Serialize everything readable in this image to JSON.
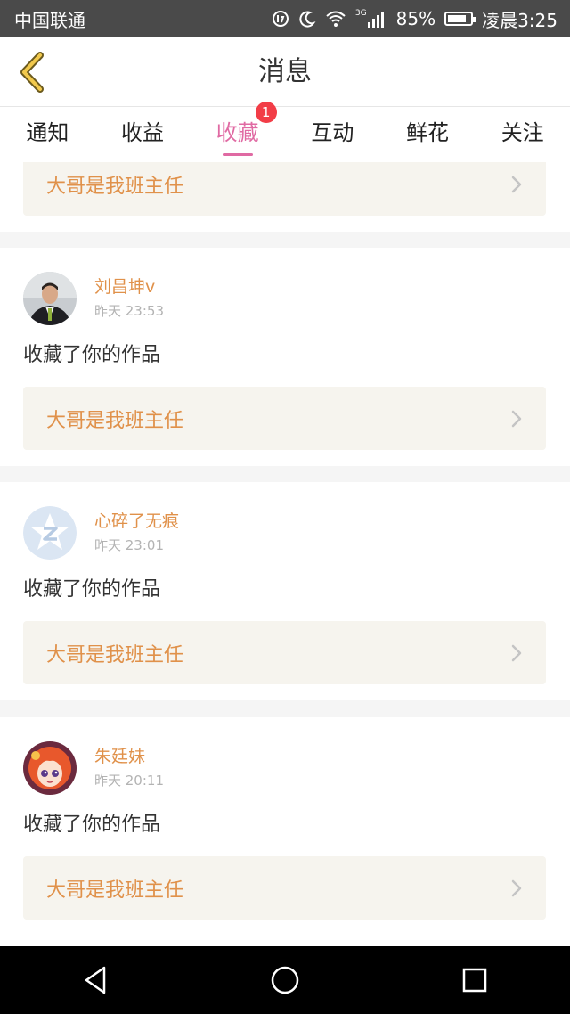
{
  "status_bar": {
    "carrier": "中国联通",
    "network": "3G",
    "battery": "85%",
    "battery_level": 0.85,
    "time": "凌晨3:25"
  },
  "header": {
    "title": "消息",
    "back_icon": "chevron-left-icon"
  },
  "tabs": [
    {
      "label": "通知"
    },
    {
      "label": "收益"
    },
    {
      "label": "收藏",
      "active": true,
      "badge": "1"
    },
    {
      "label": "互动"
    },
    {
      "label": "鲜花"
    },
    {
      "label": "关注"
    }
  ],
  "messages": [
    {
      "work_title": "大哥是我班主任"
    },
    {
      "user": "刘昌坤v",
      "time": "昨天 23:53",
      "action": "收藏了你的作品",
      "work_title": "大哥是我班主任"
    },
    {
      "user": "心碎了无痕",
      "time": "昨天 23:01",
      "action": "收藏了你的作品",
      "work_title": "大哥是我班主任"
    },
    {
      "user": "朱廷妹",
      "time": "昨天 20:11",
      "action": "收藏了你的作品",
      "work_title": "大哥是我班主任"
    }
  ],
  "colors": {
    "accent_pink": "#e06aa3",
    "name_orange": "#e0914a",
    "badge_red": "#f23d47",
    "work_bg": "#f6f4ee"
  }
}
